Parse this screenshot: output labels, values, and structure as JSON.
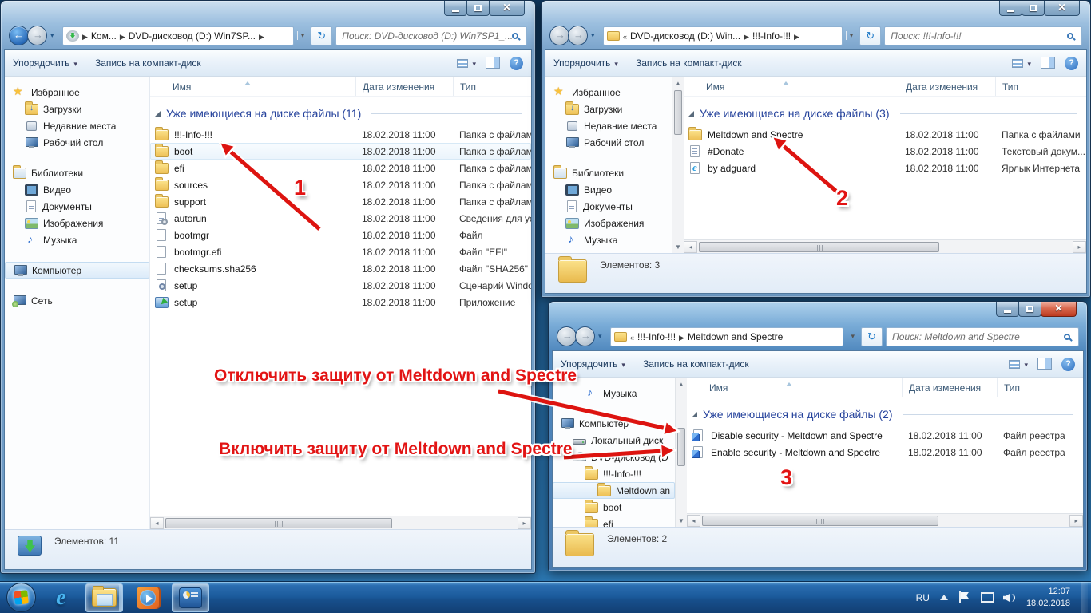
{
  "common": {
    "organize": "Упорядочить",
    "burn": "Запись на компакт-диск",
    "col_name": "Имя",
    "col_date": "Дата изменения",
    "col_type": "Тип"
  },
  "left": {
    "crumbs": [
      {
        "sep": "▶",
        "label": "Ком..."
      },
      {
        "sep": "▶",
        "label": "DVD-дисковод (D:) Win7SP..."
      },
      {
        "sep": "▶",
        "label": ""
      }
    ],
    "search": "Поиск: DVD-дисковод (D:) Win7SP1_...",
    "group": "Уже имеющиеся на диске файлы (11)",
    "rows": [
      {
        "icon": "folder",
        "name": "!!!-Info-!!!",
        "date": "18.02.2018 11:00",
        "type": "Папка с файлами"
      },
      {
        "icon": "folder",
        "name": "boot",
        "date": "18.02.2018 11:00",
        "type": "Папка с файлами",
        "state": "hover"
      },
      {
        "icon": "folder",
        "name": "efi",
        "date": "18.02.2018 11:00",
        "type": "Папка с файлами"
      },
      {
        "icon": "folder",
        "name": "sources",
        "date": "18.02.2018 11:00",
        "type": "Папка с файлами"
      },
      {
        "icon": "folder",
        "name": "support",
        "date": "18.02.2018 11:00",
        "type": "Папка с файлами"
      },
      {
        "icon": "setupinfo",
        "name": "autorun",
        "date": "18.02.2018 11:00",
        "type": "Сведения для уст..."
      },
      {
        "icon": "file",
        "name": "bootmgr",
        "date": "18.02.2018 11:00",
        "type": "Файл"
      },
      {
        "icon": "file",
        "name": "bootmgr.efi",
        "date": "18.02.2018 11:00",
        "type": "Файл \"EFI\""
      },
      {
        "icon": "file",
        "name": "checksums.sha256",
        "date": "18.02.2018 11:00",
        "type": "Файл \"SHA256\""
      },
      {
        "icon": "script",
        "name": "setup",
        "date": "18.02.2018 11:00",
        "type": "Сценарий Windo..."
      },
      {
        "icon": "app",
        "name": "setup",
        "date": "18.02.2018 11:00",
        "type": "Приложение"
      }
    ],
    "sidebar": [
      {
        "icon": "star",
        "label": "Избранное",
        "indent": 0
      },
      {
        "icon": "folder-down",
        "label": "Загрузки",
        "indent": 1
      },
      {
        "icon": "recent",
        "label": "Недавние места",
        "indent": 1
      },
      {
        "icon": "desktop",
        "label": "Рабочий стол",
        "indent": 1
      },
      {
        "icon": "",
        "label": "",
        "indent": 0,
        "state": "spacer"
      },
      {
        "icon": "library",
        "label": "Библиотеки",
        "indent": 0
      },
      {
        "icon": "video",
        "label": "Видео",
        "indent": 1
      },
      {
        "icon": "doc",
        "label": "Документы",
        "indent": 1
      },
      {
        "icon": "pic",
        "label": "Изображения",
        "indent": 1
      },
      {
        "icon": "music",
        "label": "Музыка",
        "indent": 1
      },
      {
        "icon": "",
        "label": "",
        "indent": 0,
        "state": "spacer"
      },
      {
        "icon": "computer",
        "label": "Компьютер",
        "indent": 0,
        "state": "selected"
      },
      {
        "icon": "",
        "label": "",
        "indent": 0,
        "state": "spacer"
      },
      {
        "icon": "network",
        "label": "Сеть",
        "indent": 0
      }
    ],
    "status": "Элементов: 11"
  },
  "topright": {
    "crumbs": [
      {
        "sep": "«",
        "label": "DVD-дисковод (D:) Win..."
      },
      {
        "sep": "▶",
        "label": "!!!-Info-!!!"
      },
      {
        "sep": "▶",
        "label": ""
      }
    ],
    "search": "Поиск: !!!-Info-!!!",
    "group": "Уже имеющиеся на диске файлы (3)",
    "rows": [
      {
        "icon": "folder",
        "name": "Meltdown and Spectre",
        "date": "18.02.2018 11:00",
        "type": "Папка с файлами"
      },
      {
        "icon": "textdoc",
        "name": "#Donate",
        "date": "18.02.2018 11:00",
        "type": "Текстовый докум..."
      },
      {
        "icon": "ielink",
        "name": "by adguard",
        "date": "18.02.2018 11:00",
        "type": "Ярлык Интернета"
      }
    ],
    "sidebar": [
      {
        "icon": "star",
        "label": "Избранное",
        "indent": 0
      },
      {
        "icon": "folder-down",
        "label": "Загрузки",
        "indent": 1
      },
      {
        "icon": "recent",
        "label": "Недавние места",
        "indent": 1
      },
      {
        "icon": "desktop",
        "label": "Рабочий стол",
        "indent": 1
      },
      {
        "icon": "",
        "label": "",
        "indent": 0,
        "state": "spacer"
      },
      {
        "icon": "library",
        "label": "Библиотеки",
        "indent": 0
      },
      {
        "icon": "video",
        "label": "Видео",
        "indent": 1
      },
      {
        "icon": "doc",
        "label": "Документы",
        "indent": 1
      },
      {
        "icon": "pic",
        "label": "Изображения",
        "indent": 1
      },
      {
        "icon": "music",
        "label": "Музыка",
        "indent": 1
      }
    ],
    "status": "Элементов: 3"
  },
  "bottomright": {
    "crumbs": [
      {
        "sep": "«",
        "label": "!!!-Info-!!!"
      },
      {
        "sep": "▶",
        "label": "Meltdown and Spectre"
      }
    ],
    "search": "Поиск: Meltdown and Spectre",
    "group": "Уже имеющиеся на диске файлы (2)",
    "rows": [
      {
        "icon": "reg",
        "name": "Disable security - Meltdown and Spectre",
        "date": "18.02.2018 11:00",
        "type": "Файл реестра"
      },
      {
        "icon": "reg",
        "name": "Enable security - Meltdown and Spectre",
        "date": "18.02.2018 11:00",
        "type": "Файл реестра"
      }
    ],
    "sidebar": [
      {
        "icon": "music",
        "label": "Музыка",
        "indent": 2
      },
      {
        "icon": "",
        "label": "",
        "indent": 0,
        "state": "spacer"
      },
      {
        "icon": "computer",
        "label": "Компьютер",
        "indent": 0
      },
      {
        "icon": "drive",
        "label": "Локальный диск",
        "indent": 1
      },
      {
        "icon": "dvd",
        "label": "DVD-дисковод (D",
        "indent": 1
      },
      {
        "icon": "folder",
        "label": "!!!-Info-!!!",
        "indent": 2
      },
      {
        "icon": "folder",
        "label": "Meltdown an",
        "indent": 3,
        "state": "selected"
      },
      {
        "icon": "folder",
        "label": "boot",
        "indent": 2
      },
      {
        "icon": "folder",
        "label": "efi",
        "indent": 2
      }
    ],
    "status": "Элементов: 2"
  },
  "annotations": {
    "text_disable": "Отключить защиту от Meltdown and Spectre",
    "text_enable": "Включить защиту от Meltdown and Spectre",
    "step1": "1",
    "step2": "2",
    "step3": "3",
    "arrow_color": "#dd1410"
  },
  "taskbar": {
    "apps": [
      {
        "icon": "ie"
      },
      {
        "icon": "explorer",
        "state": "active grouped"
      },
      {
        "icon": "wmp"
      },
      {
        "icon": "panel",
        "state": "active"
      }
    ],
    "lang": "RU",
    "time": "12:07",
    "date": "18.02.2018"
  }
}
